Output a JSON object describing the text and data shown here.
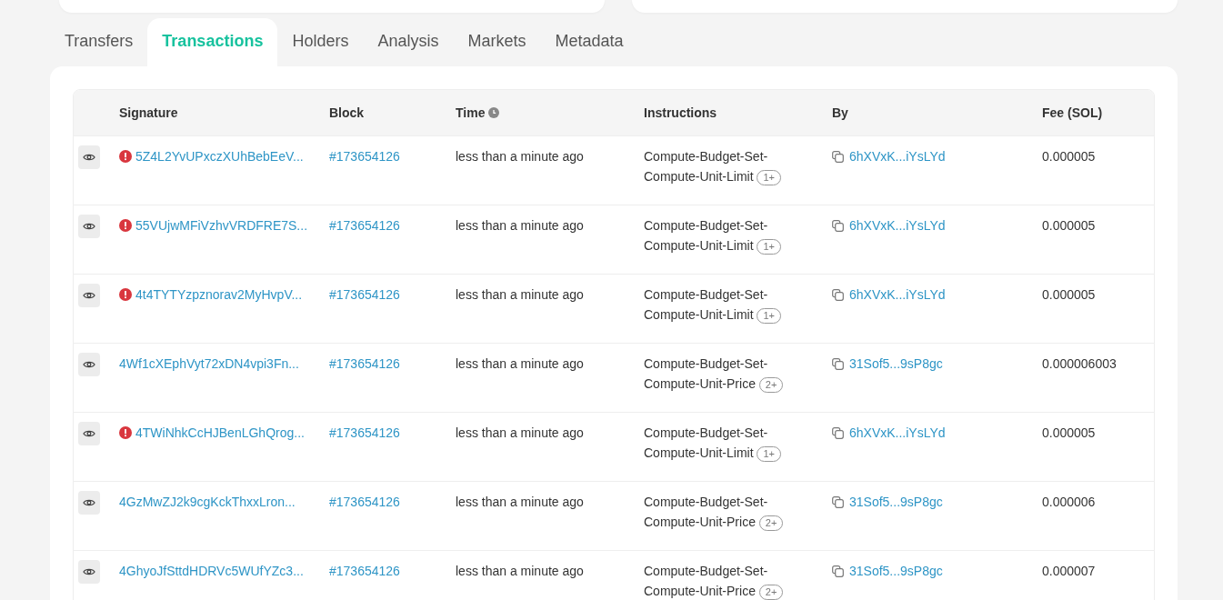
{
  "tabs": [
    {
      "label": "Transfers",
      "selected": false
    },
    {
      "label": "Transactions",
      "selected": true
    },
    {
      "label": "Holders",
      "selected": false
    },
    {
      "label": "Analysis",
      "selected": false
    },
    {
      "label": "Markets",
      "selected": false
    },
    {
      "label": "Metadata",
      "selected": false
    }
  ],
  "table": {
    "columns": [
      "Signature",
      "Block",
      "Time",
      "Instructions",
      "By",
      "Fee (SOL)"
    ],
    "rows": [
      {
        "failed": true,
        "signature": "5Z4L2YvUPxczXUhBebEeV...",
        "block": "#173654126",
        "time": "less than a minute ago",
        "instruction": "Compute-Budget-Set-Compute-Unit-Limit",
        "more": "1+",
        "by": "6hXVxK...iYsLYd",
        "fee": "0.000005"
      },
      {
        "failed": true,
        "signature": "55VUjwMFiVzhvVRDFRE7S...",
        "block": "#173654126",
        "time": "less than a minute ago",
        "instruction": "Compute-Budget-Set-Compute-Unit-Limit",
        "more": "1+",
        "by": "6hXVxK...iYsLYd",
        "fee": "0.000005"
      },
      {
        "failed": true,
        "signature": "4t4TYTYzpznorav2MyHvpV...",
        "block": "#173654126",
        "time": "less than a minute ago",
        "instruction": "Compute-Budget-Set-Compute-Unit-Limit",
        "more": "1+",
        "by": "6hXVxK...iYsLYd",
        "fee": "0.000005"
      },
      {
        "failed": false,
        "signature": "4Wf1cXEphVyt72xDN4vpi3Fn...",
        "block": "#173654126",
        "time": "less than a minute ago",
        "instruction": "Compute-Budget-Set-Compute-Unit-Price",
        "more": "2+",
        "by": "31Sof5...9sP8gc",
        "fee": "0.000006003"
      },
      {
        "failed": true,
        "signature": "4TWiNhkCcHJBenLGhQrog...",
        "block": "#173654126",
        "time": "less than a minute ago",
        "instruction": "Compute-Budget-Set-Compute-Unit-Limit",
        "more": "1+",
        "by": "6hXVxK...iYsLYd",
        "fee": "0.000005"
      },
      {
        "failed": false,
        "signature": "4GzMwZJ2k9cgKckThxxLron...",
        "block": "#173654126",
        "time": "less than a minute ago",
        "instruction": "Compute-Budget-Set-Compute-Unit-Price",
        "more": "2+",
        "by": "31Sof5...9sP8gc",
        "fee": "0.000006"
      },
      {
        "failed": false,
        "signature": "4GhyoJfSttdHDRVc5WUfYZc3...",
        "block": "#173654126",
        "time": "less than a minute ago",
        "instruction": "Compute-Budget-Set-Compute-Unit-Price",
        "more": "2+",
        "by": "31Sof5...9sP8gc",
        "fee": "0.000007"
      }
    ]
  }
}
